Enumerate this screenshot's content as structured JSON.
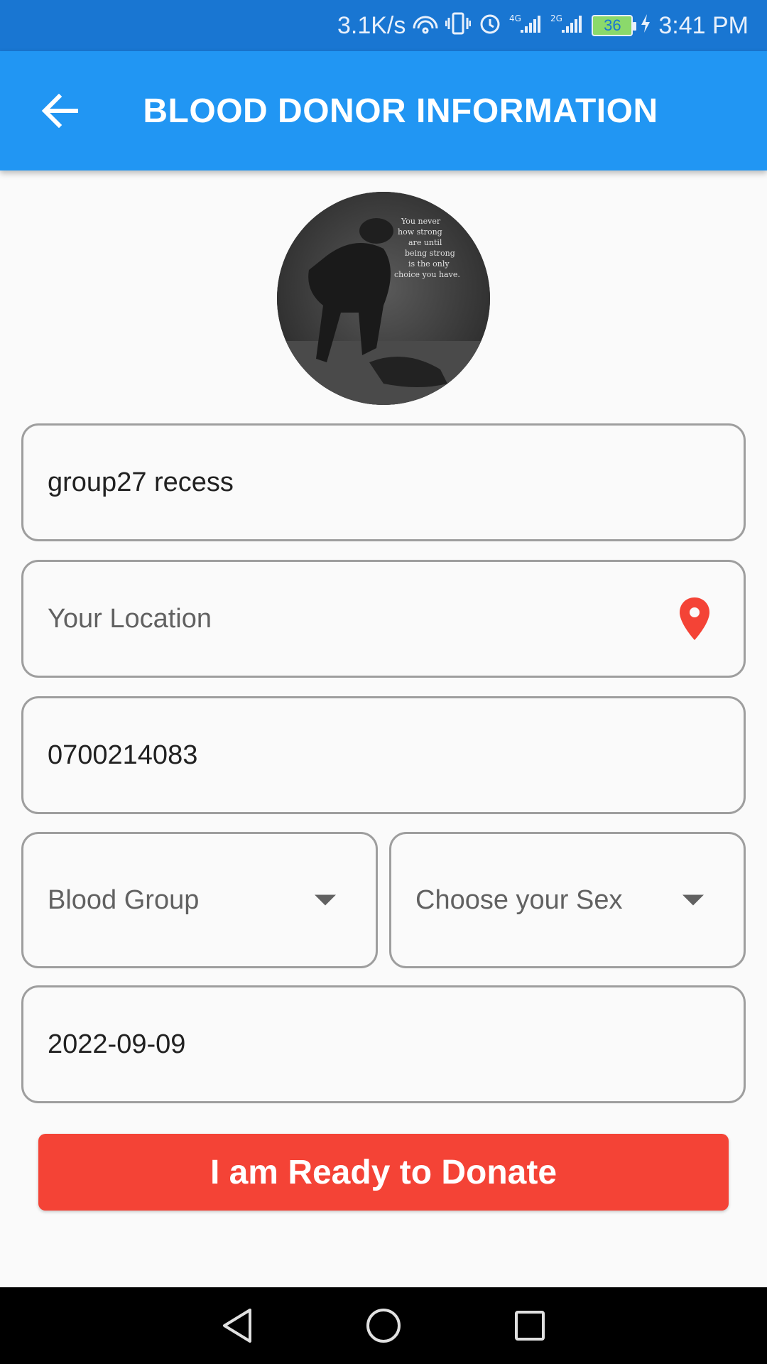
{
  "status_bar": {
    "network_speed": "3.1K/s",
    "battery": "36",
    "time": "3:41 PM"
  },
  "app_bar": {
    "title": "BLOOD DONOR INFORMATION",
    "back_icon": "arrow-back-icon"
  },
  "avatar": {
    "caption": "You never know how strong you are until being strong is the only choice you have."
  },
  "form": {
    "name_value": "group27 recess",
    "location_placeholder": "Your Location",
    "location_icon": "location-pin-icon",
    "phone_value": "0700214083",
    "blood_group_placeholder": "Blood Group",
    "sex_placeholder": "Choose your Sex",
    "date_value": "2022-09-09"
  },
  "donate_button": {
    "label": "I am Ready to Donate"
  },
  "colors": {
    "status_bar": "#1976d2",
    "app_bar": "#2196f3",
    "accent_red": "#f44336",
    "border": "#9e9e9e"
  },
  "nav_bar": {
    "back": "nav-back-icon",
    "home": "nav-home-icon",
    "recents": "nav-recents-icon"
  }
}
